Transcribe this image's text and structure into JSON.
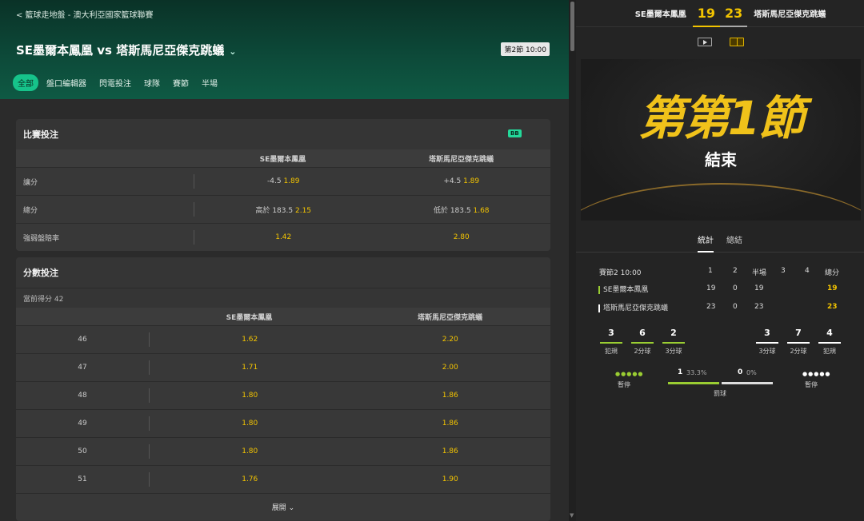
{
  "breadcrumb": "< 籃球走地盤 - 澳大利亞國家籃球聯賽",
  "match_title": "SE墨爾本鳳凰 vs 塔斯馬尼亞傑克跳蟻",
  "period_badge": "第2節 10:00",
  "tabs": [
    "全部",
    "盤口編輯器",
    "閃電投注",
    "球隊",
    "賽節",
    "半場"
  ],
  "match_bets": {
    "title": "比賽投注",
    "badge": "BB",
    "teams": [
      "SE墨爾本鳳凰",
      "塔斯馬尼亞傑克跳蟻"
    ],
    "rows": [
      {
        "label": "讓分",
        "a_line": "-4.5",
        "a_odds": "1.89",
        "b_line": "+4.5",
        "b_odds": "1.89"
      },
      {
        "label": "總分",
        "a_line": "高於 183.5",
        "a_odds": "2.15",
        "b_line": "低於 183.5",
        "b_odds": "1.68"
      },
      {
        "label": "強弱盤賠率",
        "a_line": "",
        "a_odds": "1.42",
        "b_line": "",
        "b_odds": "2.80"
      }
    ]
  },
  "score_bets": {
    "title": "分數投注",
    "current": "當前得分 42",
    "teams": [
      "SE墨爾本鳳凰",
      "塔斯馬尼亞傑克跳蟻"
    ],
    "rows": [
      {
        "label": "46",
        "a": "1.62",
        "b": "2.20"
      },
      {
        "label": "47",
        "a": "1.71",
        "b": "2.00"
      },
      {
        "label": "48",
        "a": "1.80",
        "b": "1.86"
      },
      {
        "label": "49",
        "a": "1.80",
        "b": "1.86"
      },
      {
        "label": "50",
        "a": "1.80",
        "b": "1.86"
      },
      {
        "label": "51",
        "a": "1.76",
        "b": "1.90"
      }
    ],
    "expand": "展開 ⌄"
  },
  "scoreboard": {
    "home": "SE墨爾本鳳凰",
    "home_score": "19",
    "away_score": "23",
    "away": "塔斯馬尼亞傑克跳蟻"
  },
  "banner": {
    "main": "第第1節",
    "sub": "結束"
  },
  "right_tabs": [
    "統計",
    "總結"
  ],
  "boxscore": {
    "period": "賽節2 10:00",
    "cols": [
      "1",
      "2",
      "半場",
      "3",
      "4",
      "總分"
    ],
    "home": {
      "name": "SE墨爾本鳳凰",
      "q": [
        "19",
        "0",
        "19",
        "",
        "",
        "19"
      ],
      "color": "#9acd32"
    },
    "away": {
      "name": "塔斯馬尼亞傑克跳蟻",
      "q": [
        "23",
        "0",
        "23",
        "",
        "",
        "23"
      ],
      "color": "#ffffff"
    }
  },
  "stats": {
    "home": [
      {
        "v": "3",
        "l": "犯規"
      },
      {
        "v": "6",
        "l": "2分球"
      },
      {
        "v": "2",
        "l": "3分球"
      }
    ],
    "away": [
      {
        "v": "3",
        "l": "3分球"
      },
      {
        "v": "7",
        "l": "2分球"
      },
      {
        "v": "4",
        "l": "犯規"
      }
    ],
    "timeout_label": "暫停",
    "ft_home": "1",
    "ft_home_pct": "33.3%",
    "ft_away": "0",
    "ft_away_pct": "0%",
    "ft_label": "罰球"
  },
  "colors": {
    "accent": "#16c38a",
    "odds": "#f3c400"
  }
}
